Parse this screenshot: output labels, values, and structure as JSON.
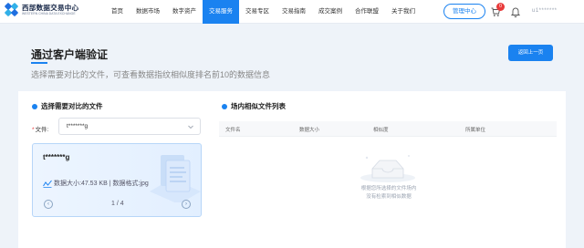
{
  "brand": {
    "name_cn": "西部数据交易中心",
    "name_en": "WESTERN CHINA DATA EXCHANGE"
  },
  "nav": {
    "items": [
      "首页",
      "数据市场",
      "数字资产",
      "交易服务",
      "交易专区",
      "交易指南",
      "成交案例",
      "合作联盟",
      "关于我们"
    ],
    "active": "交易服务"
  },
  "header_actions": {
    "admin_label": "管理中心",
    "cart_badge": "0",
    "username": "u1*******"
  },
  "page": {
    "title": "通过客户端验证",
    "subtitle": "选择需要对比的文件，可查看数据指纹相似度排名前10的数据信息",
    "back_label": "返回上一页"
  },
  "left_panel": {
    "title": "选择需要对比的文件",
    "file_label": "文件:",
    "required_mark": "*",
    "selected_file": "t*******g",
    "file_card": {
      "name": "t*******g",
      "meta": "数据大小:47.53 KB | 数据格式:jpg",
      "page": "1 / 4"
    }
  },
  "right_panel": {
    "title": "场内相似文件列表",
    "columns": [
      "文件名",
      "数据大小",
      "相似度",
      "所属单位"
    ],
    "empty_line1": "根据您所选择的文件场内",
    "empty_line2": "没有检索到相似数据"
  },
  "colors": {
    "accent": "#1a82f0",
    "badge": "#e83a3a",
    "background": "#eef3f9"
  }
}
